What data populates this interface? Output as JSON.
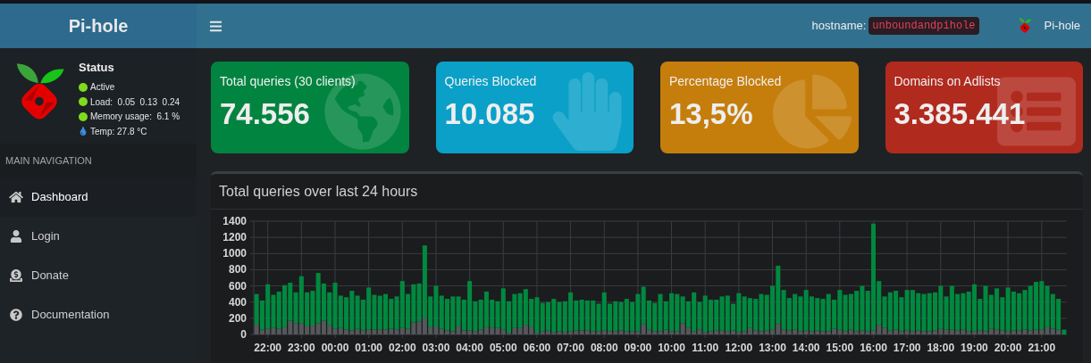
{
  "header": {
    "brand": "Pi-hole",
    "hostname_label": "hostname:",
    "hostname": "unboundandpihole",
    "user": "Pi-hole"
  },
  "status": {
    "title": "Status",
    "items": [
      {
        "kind": "dot",
        "text": "Active"
      },
      {
        "kind": "dot",
        "text": "Load:  0.05  0.13  0.24"
      },
      {
        "kind": "dot",
        "text": "Memory usage:  6.1 %"
      },
      {
        "kind": "temp",
        "text": "Temp: 27.8 °C"
      }
    ]
  },
  "sidebar": {
    "header": "MAIN NAVIGATION",
    "items": [
      {
        "label": "Dashboard",
        "selected": true
      },
      {
        "label": "Login",
        "selected": false
      },
      {
        "label": "Donate",
        "selected": false
      },
      {
        "label": "Documentation",
        "selected": false
      }
    ]
  },
  "cards": [
    {
      "title": "Total queries (30 clients)",
      "value": "74.556",
      "color": "#00843f"
    },
    {
      "title": "Queries Blocked",
      "value": "10.085",
      "color": "#0aa0c8"
    },
    {
      "title": "Percentage Blocked",
      "value": "13,5%",
      "color": "#c57e0c"
    },
    {
      "title": "Domains on Adlists",
      "value": "3.385.441",
      "color": "#b12a1e"
    }
  ],
  "chart_panel": {
    "title": "Total queries over last 24 hours",
    "chart_data": {
      "type": "bar",
      "stacked": true,
      "grid": true,
      "ylim": [
        0,
        1400
      ],
      "yticks": [
        0,
        200,
        400,
        600,
        800,
        1000,
        1200,
        1400
      ],
      "categories": [
        null,
        null,
        "22:00",
        null,
        null,
        null,
        null,
        null,
        "23:00",
        null,
        null,
        null,
        null,
        null,
        "00:00",
        null,
        null,
        null,
        null,
        null,
        "01:00",
        null,
        null,
        null,
        null,
        null,
        "02:00",
        null,
        null,
        null,
        null,
        null,
        "03:00",
        null,
        null,
        null,
        null,
        null,
        "04:00",
        null,
        null,
        null,
        null,
        null,
        "05:00",
        null,
        null,
        null,
        null,
        null,
        "06:00",
        null,
        null,
        null,
        null,
        null,
        "07:00",
        null,
        null,
        null,
        null,
        null,
        "08:00",
        null,
        null,
        null,
        null,
        null,
        "09:00",
        null,
        null,
        null,
        null,
        null,
        "10:00",
        null,
        null,
        null,
        null,
        null,
        "11:00",
        null,
        null,
        null,
        null,
        null,
        "12:00",
        null,
        null,
        null,
        null,
        null,
        "13:00",
        null,
        null,
        null,
        null,
        null,
        "14:00",
        null,
        null,
        null,
        null,
        null,
        "15:00",
        null,
        null,
        null,
        null,
        null,
        "16:00",
        null,
        null,
        null,
        null,
        null,
        "17:00",
        null,
        null,
        null,
        null,
        null,
        "18:00",
        null,
        null,
        null,
        null,
        null,
        "19:00",
        null,
        null,
        null,
        null,
        null,
        "20:00",
        null,
        null,
        null,
        null,
        null,
        "21:00",
        null,
        null,
        null,
        null
      ],
      "series": [
        {
          "color": "#55575b",
          "values": [
            120,
            60,
            70,
            80,
            70,
            90,
            170,
            140,
            140,
            100,
            110,
            140,
            170,
            120,
            70,
            80,
            60,
            50,
            70,
            50,
            60,
            60,
            60,
            60,
            70,
            60,
            80,
            70,
            150,
            160,
            200,
            90,
            100,
            70,
            50,
            40,
            100,
            50,
            50,
            40,
            60,
            90,
            80,
            80,
            60,
            20,
            80,
            80,
            120,
            90,
            20,
            40,
            50,
            30,
            40,
            30,
            40,
            50,
            50,
            50,
            40,
            40,
            50,
            40,
            40,
            50,
            40,
            40,
            40,
            130,
            60,
            40,
            40,
            60,
            40,
            40,
            140,
            80,
            40,
            60,
            30,
            40,
            50,
            50,
            40,
            50,
            30,
            40,
            80,
            50,
            40,
            50,
            60,
            130,
            60,
            50,
            60,
            40,
            50,
            40,
            50,
            40,
            40,
            70,
            60,
            40,
            60,
            40,
            50,
            40,
            50,
            120,
            80,
            50,
            60,
            40,
            50,
            40,
            50,
            40,
            40,
            50,
            70,
            60,
            60,
            50,
            60,
            40,
            40,
            50,
            40,
            70,
            60,
            50,
            40,
            50,
            50,
            60,
            50,
            60,
            60,
            90,
            70,
            60,
            0
          ]
        },
        {
          "color": "#00893f",
          "values": [
            380,
            360,
            550,
            410,
            460,
            520,
            470,
            380,
            580,
            420,
            430,
            620,
            460,
            400,
            570,
            400,
            400,
            490,
            410,
            380,
            520,
            430,
            420,
            440,
            370,
            410,
            580,
            430,
            470,
            470,
            900,
            380,
            500,
            410,
            390,
            430,
            370,
            380,
            610,
            370,
            370,
            440,
            350,
            330,
            510,
            390,
            420,
            430,
            440,
            350,
            440,
            350,
            350,
            410,
            360,
            380,
            480,
            370,
            380,
            370,
            380,
            340,
            470,
            340,
            370,
            350,
            400,
            360,
            460,
            460,
            360,
            350,
            460,
            350,
            470,
            460,
            330,
            330,
            480,
            340,
            450,
            390,
            380,
            420,
            440,
            330,
            480,
            430,
            370,
            390,
            460,
            440,
            540,
            720,
            490,
            400,
            440,
            430,
            500,
            430,
            400,
            400,
            460,
            360,
            490,
            450,
            440,
            500,
            550,
            500,
            1320,
            540,
            390,
            470,
            480,
            420,
            500,
            510,
            460,
            460,
            470,
            470,
            530,
            410,
            540,
            450,
            450,
            490,
            580,
            390,
            560,
            420,
            510,
            410,
            540,
            480,
            460,
            490,
            550,
            590,
            600,
            510,
            430,
            380,
            60
          ]
        }
      ]
    }
  }
}
